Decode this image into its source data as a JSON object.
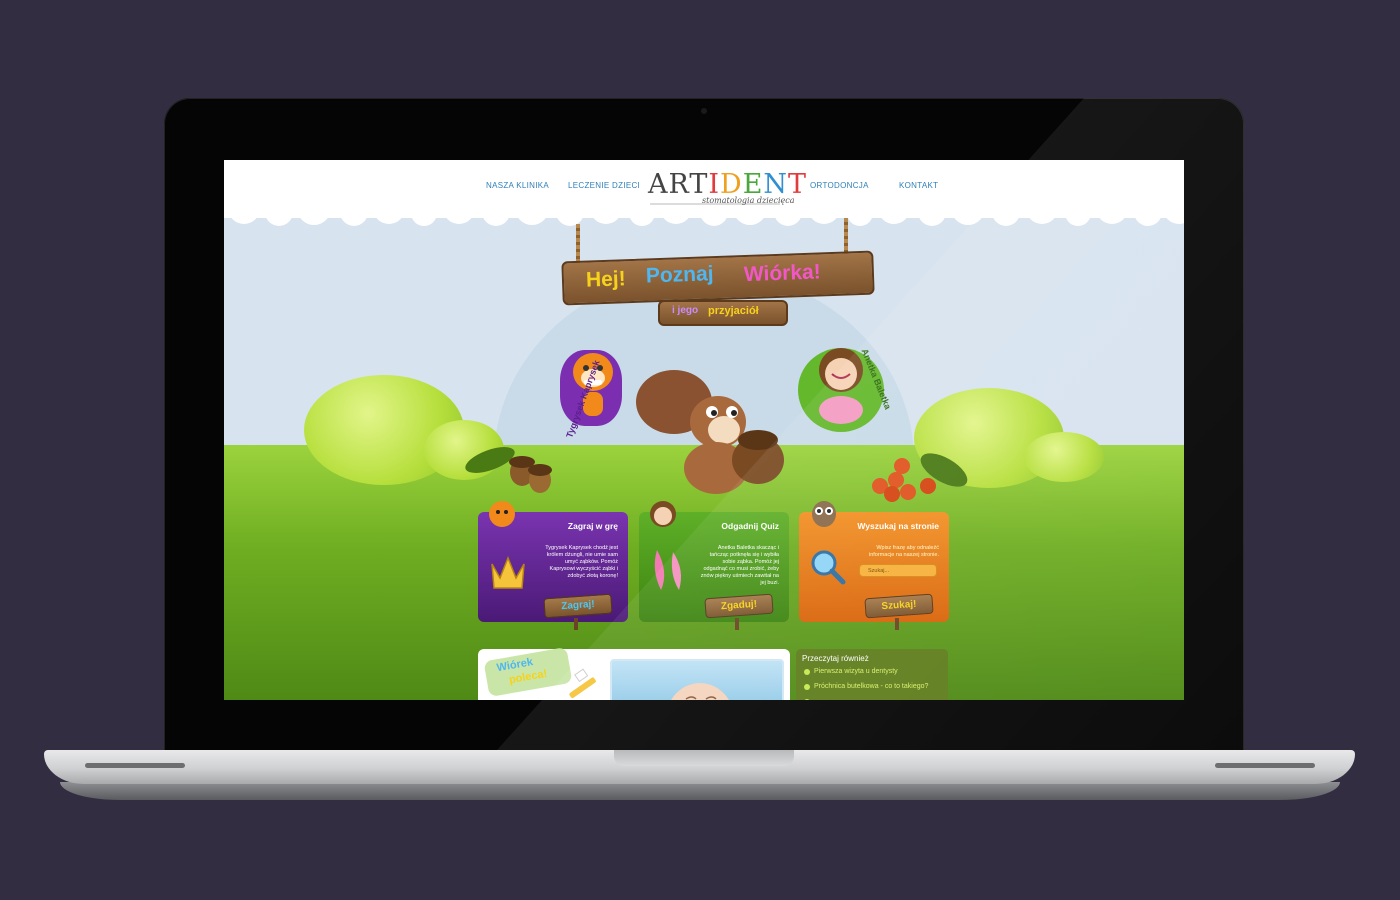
{
  "nav": {
    "items": [
      {
        "label": "NASZA KLINIKA"
      },
      {
        "label": "LECZENIE DZIECI"
      },
      {
        "label": "ORTODONCJA"
      },
      {
        "label": "KONTAKT"
      }
    ]
  },
  "logo": {
    "part1": "ART",
    "letters": [
      "I",
      "D",
      "E",
      "N",
      "T"
    ],
    "tagline": "stomatologia dziecięca"
  },
  "hero": {
    "sign_main": [
      "Hej!",
      "Poznaj",
      "Wiórka!"
    ],
    "sign_sub": [
      "i jego",
      "przyjaciół"
    ],
    "left_character": "Tygrysek Kaprysek",
    "right_character": "Anetka Baletka"
  },
  "cards": [
    {
      "title": "Zagraj w grę",
      "text": "Tygrysek Kaprysek chodź jest królem dżungli, nie umie sam umyć ząbków. Pomóż Kaprysowi wyczyścić ząbki i zdobyć złotą koronę!",
      "button": "Zagraj!",
      "color": "#5a1f8c"
    },
    {
      "title": "Odgadnij Quiz",
      "text": "Anetka Baletka skacząc i tańcząc potknęła się i wybiła sobie ząbka. Pomóż jej odgadnąć co musi zrobić, żeby znów piękny uśmiech zawitał na jej buzi.",
      "button": "Zgaduj!",
      "color": "#4f9a1a"
    },
    {
      "title": "Wyszukaj na stronie",
      "text": "Wpisz frazę aby odnaleźć informacje na naszej stronie.",
      "search_placeholder": "Szukaj...",
      "button": "Szukaj!",
      "color": "#e8780d"
    }
  ],
  "recommend": {
    "badge_line1": "Wiórek",
    "badge_line2": "poleca!"
  },
  "read_more": {
    "title": "Przeczytaj również",
    "links": [
      "Pierwsza wizyta u dentysty",
      "Próchnica butelkowa - co to takiego?"
    ]
  },
  "colors": {
    "page_bg": "#332d41",
    "nav_text": "#2f7fb8",
    "grass": "#7cbc26"
  }
}
